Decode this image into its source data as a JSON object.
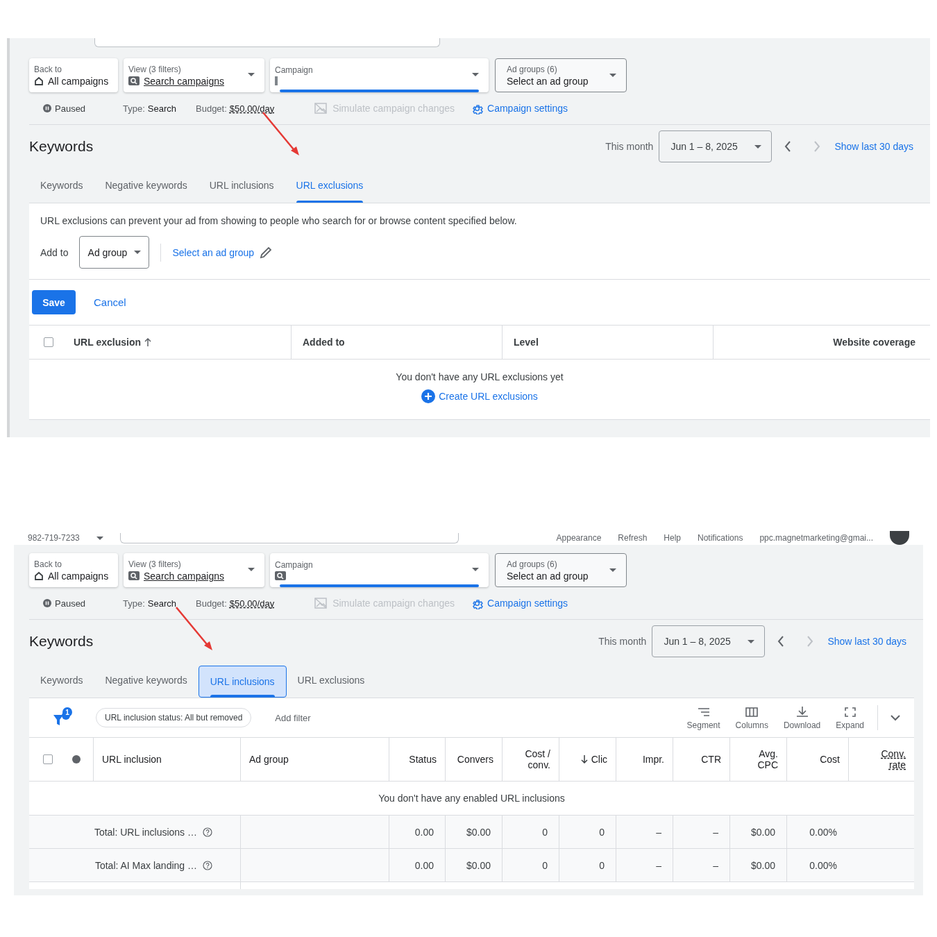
{
  "screens": [
    {
      "kind": "exclusions",
      "nav": [
        {
          "kind": "back",
          "label": "Back to",
          "value": "All campaigns"
        },
        {
          "kind": "view",
          "label": "View (3 filters)",
          "value": "Search campaigns"
        },
        {
          "kind": "campaign",
          "label": "Campaign",
          "focused": true
        },
        {
          "kind": "adgroups",
          "label": "Ad groups (6)",
          "value": "Select an ad group"
        }
      ],
      "status": {
        "state": "Paused",
        "type_label": "Type:",
        "type": "Search",
        "budget_label": "Budget:",
        "budget": "$50.00/day",
        "simulate": "Simulate campaign changes",
        "settings": "Campaign settings"
      },
      "title": "Keywords",
      "date_label": "This month",
      "date": "Jun 1 – 8, 2025",
      "show_last": "Show last 30 days",
      "tabs": [
        {
          "label": "Keywords",
          "selected": false
        },
        {
          "label": "Negative keywords",
          "selected": false
        },
        {
          "label": "URL inclusions",
          "selected": false
        },
        {
          "label": "URL exclusions",
          "selected": true
        }
      ],
      "body": {
        "select_all_checked": false,
        "description": "URL exclusions can prevent your ad from showing to people who search for or browse content specified below.",
        "add_to_label": "Add to",
        "level_select": "Ad group",
        "select_link": "Select an ad group",
        "save": "Save",
        "cancel": "Cancel",
        "columns": [
          {
            "label": "URL exclusion",
            "sorted": true
          },
          {
            "label": "Added to",
            "sorted": false
          },
          {
            "label": "Level",
            "sorted": false
          },
          {
            "label": "Website coverage",
            "sorted": false
          }
        ],
        "empty": "You don't have any URL exclusions yet",
        "create": "Create URL exclusions"
      }
    },
    {
      "kind": "inclusions",
      "header": {
        "phone": "982-719-7233",
        "links": [
          "Appearance",
          "Refresh",
          "Help",
          "Notifications"
        ],
        "email": "ppc.magnetmarketing@gmai..."
      },
      "nav": [
        {
          "kind": "back",
          "label": "Back to",
          "value": "All campaigns"
        },
        {
          "kind": "view",
          "label": "View (3 filters)",
          "value": "Search campaigns"
        },
        {
          "kind": "campaign",
          "label": "Campaign",
          "focused": false
        },
        {
          "kind": "adgroups",
          "label": "Ad groups (6)",
          "value": "Select an ad group"
        }
      ],
      "status": {
        "state": "Paused",
        "type_label": "Type:",
        "type": "Search",
        "budget_label": "Budget:",
        "budget": "$50.00/day",
        "simulate": "Simulate campaign changes",
        "settings": "Campaign settings"
      },
      "title": "Keywords",
      "date_label": "This month",
      "date": "Jun 1 – 8, 2025",
      "show_last": "Show last 30 days",
      "tabs": [
        {
          "label": "Keywords",
          "selected": false
        },
        {
          "label": "Negative keywords",
          "selected": false
        },
        {
          "label": "URL inclusions",
          "selected": true
        },
        {
          "label": "URL exclusions",
          "selected": false
        }
      ],
      "body": {
        "select_all_checked": false,
        "filter_count": "1",
        "filter_chip": "URL inclusion status: All but removed",
        "add_filter": "Add filter",
        "tools": [
          {
            "kind": "segment",
            "label": "Segment"
          },
          {
            "kind": "columns",
            "label": "Columns"
          },
          {
            "kind": "download",
            "label": "Download"
          },
          {
            "kind": "expand",
            "label": "Expand"
          }
        ],
        "columns": [
          {
            "label": "URL inclusion",
            "sorted": false,
            "dashed": false
          },
          {
            "label": "Ad group",
            "sorted": false,
            "dashed": false
          },
          {
            "label": "Status",
            "sorted": false,
            "dashed": false
          },
          {
            "label": "Convers",
            "sorted": false,
            "dashed": false
          },
          {
            "label": "Cost /\nconv.",
            "sorted": false,
            "dashed": false
          },
          {
            "label": "Clic",
            "sorted": true,
            "dashed": false
          },
          {
            "label": "Impr.",
            "sorted": false,
            "dashed": false
          },
          {
            "label": "CTR",
            "sorted": false,
            "dashed": false
          },
          {
            "label": "Avg.\nCPC",
            "sorted": false,
            "dashed": false
          },
          {
            "label": "Cost",
            "sorted": false,
            "dashed": false
          },
          {
            "label": "Conv.\nrate",
            "sorted": false,
            "dashed": true
          }
        ],
        "empty": "You don't have any enabled URL inclusions",
        "totals": [
          {
            "label": "Total: URL inclusions …",
            "values": [
              "0.00",
              "$0.00",
              "0",
              "0",
              "–",
              "–",
              "$0.00",
              "0.00%"
            ]
          },
          {
            "label": "Total: AI Max landing …",
            "values": [
              "0.00",
              "$0.00",
              "0",
              "0",
              "–",
              "–",
              "$0.00",
              "0.00%"
            ]
          }
        ]
      }
    }
  ]
}
